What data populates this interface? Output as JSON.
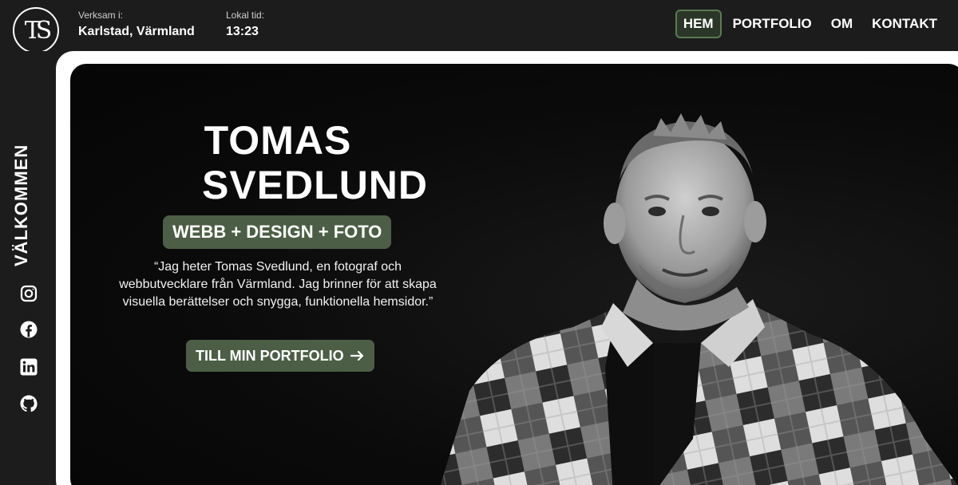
{
  "header": {
    "logo_text": "TS",
    "location_label": "Verksam i:",
    "location_value": "Karlstad, Värmland",
    "time_label": "Lokal tid:",
    "time_value": "13:23",
    "nav": [
      {
        "label": "HEM",
        "active": true
      },
      {
        "label": "PORTFOLIO",
        "active": false
      },
      {
        "label": "OM",
        "active": false
      },
      {
        "label": "KONTAKT",
        "active": false
      }
    ]
  },
  "sidebar": {
    "welcome": "VÄLKOMMEN",
    "social": [
      "instagram-icon",
      "facebook-icon",
      "linkedin-icon",
      "github-icon"
    ]
  },
  "hero": {
    "name_line1": "TOMAS",
    "name_line2": "SVEDLUND",
    "tagline": "WEBB + DESIGN + FOTO",
    "quote": "“Jag heter Tomas Svedlund, en fotograf och webbutvecklare från Värmland. Jag brinner för att skapa visuella berättelser och snygga, funktionella hemsidor.”",
    "cta_label": "TILL MIN PORTFOLIO",
    "cta_icon": "arrow-right-icon"
  },
  "colors": {
    "accent": "#4c5e45",
    "accent_border": "#5b7a52",
    "background": "#1c1c1c",
    "hero_bg": "#0b0b0b"
  }
}
